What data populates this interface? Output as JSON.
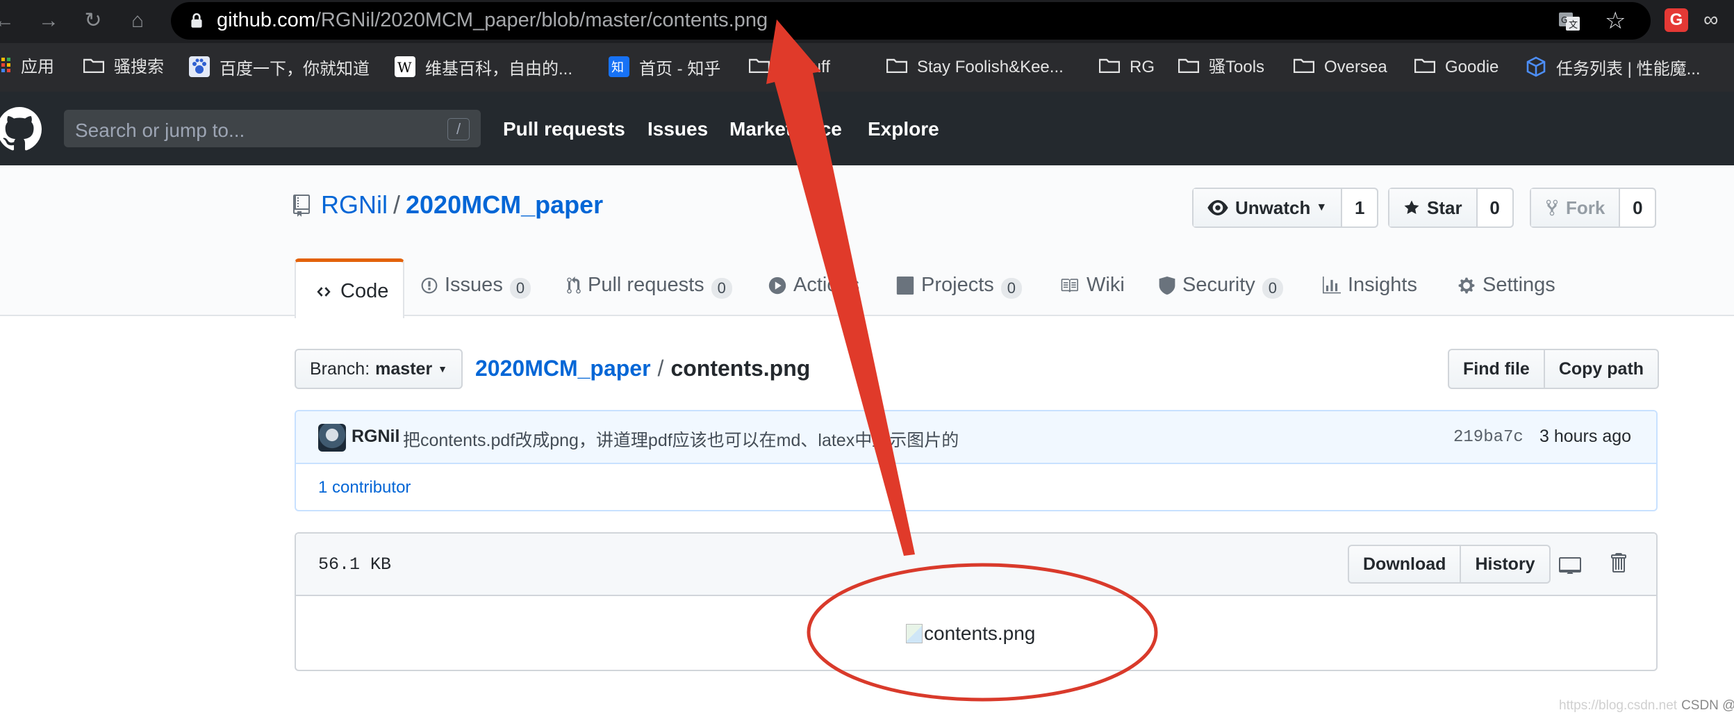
{
  "browser": {
    "url_host": "github.com",
    "url_path": "/RGNil/2020MCM_paper/blob/master/contents.png",
    "ext_red_label": "G"
  },
  "bookmarks": [
    {
      "label": "应用",
      "icon": "apps-grid-icon"
    },
    {
      "label": "骚搜索",
      "icon": "folder-icon"
    },
    {
      "label": "百度一下，你就知道",
      "icon": "baidu-paw-icon"
    },
    {
      "label": "维基百科，自由的...",
      "icon": "wikipedia-icon"
    },
    {
      "label": "首页 - 知乎",
      "icon": "zhihu-icon"
    },
    {
      "label": "U Stuff",
      "icon": "folder-icon"
    },
    {
      "label": "Stay Foolish&Kee...",
      "icon": "folder-icon"
    },
    {
      "label": "RG",
      "icon": "folder-icon"
    },
    {
      "label": "骚Tools",
      "icon": "folder-icon"
    },
    {
      "label": "Oversea",
      "icon": "folder-icon"
    },
    {
      "label": "Goodie",
      "icon": "folder-icon"
    },
    {
      "label": "任务列表 | 性能魔...",
      "icon": "cube-icon"
    }
  ],
  "gh_header": {
    "search_placeholder": "Search or jump to...",
    "search_shortcut": "/",
    "nav": [
      "Pull requests",
      "Issues",
      "Marketplace",
      "Explore"
    ]
  },
  "repo": {
    "owner": "RGNil",
    "separator": "/",
    "name": "2020MCM_paper",
    "unwatch_label": "Unwatch",
    "watch_count": "1",
    "star_label": "Star",
    "star_count": "0",
    "fork_label": "Fork",
    "fork_count": "0"
  },
  "tabs": [
    {
      "label": "Code",
      "icon": "code-icon"
    },
    {
      "label": "Issues",
      "count": "0",
      "icon": "issue-icon"
    },
    {
      "label": "Pull requests",
      "count": "0",
      "icon": "pull-request-icon"
    },
    {
      "label": "Actions",
      "icon": "play-icon"
    },
    {
      "label": "Projects",
      "count": "0",
      "icon": "project-icon"
    },
    {
      "label": "Wiki",
      "icon": "book-icon"
    },
    {
      "label": "Security",
      "count": "0",
      "icon": "shield-icon"
    },
    {
      "label": "Insights",
      "icon": "graph-icon"
    },
    {
      "label": "Settings",
      "icon": "gear-icon"
    }
  ],
  "file_nav": {
    "branch_prefix": "Branch:",
    "branch": "master",
    "breadcrumb_repo": "2020MCM_paper",
    "breadcrumb_sep": "/",
    "breadcrumb_file": "contents.png",
    "find_file": "Find file",
    "copy_path": "Copy path"
  },
  "commit": {
    "author": "RGNil",
    "message": "把contents.pdf改成png，讲道理pdf应该也可以在md、latex中显示图片的",
    "sha": "219ba7c",
    "time": "3 hours ago",
    "contributors": "1 contributor"
  },
  "file": {
    "size": "56.1 KB",
    "download": "Download",
    "history": "History",
    "image_alt": "contents.png"
  },
  "annotation": {
    "arrow_color": "#e03a2a",
    "ellipse_color": "#d93a2b"
  },
  "watermark": {
    "faint": "https://blog.csdn.net",
    "text": "CSDN @博士僧小星"
  }
}
